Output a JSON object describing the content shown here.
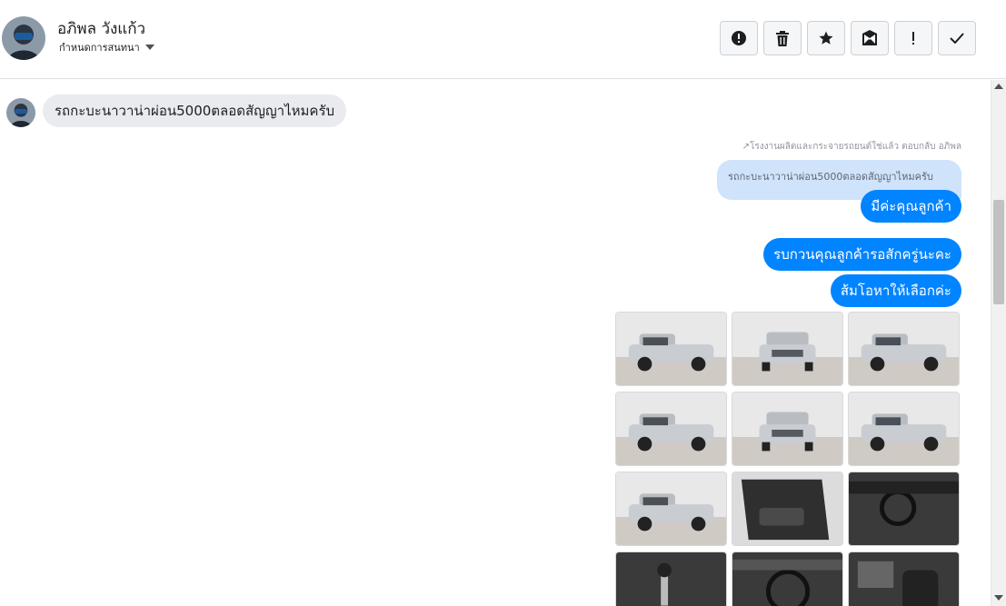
{
  "header": {
    "contact_name": "อภิพล วังแก้ว",
    "subtitle": "กำหนดการสนทนา",
    "actions": [
      {
        "icon": "alert-circle-icon",
        "name": "mark-spam-button"
      },
      {
        "icon": "trash-icon",
        "name": "delete-button"
      },
      {
        "icon": "star-icon",
        "name": "star-button"
      },
      {
        "icon": "archive-icon",
        "name": "archive-button"
      },
      {
        "icon": "exclamation-icon",
        "name": "follow-up-button"
      },
      {
        "icon": "check-icon",
        "name": "mark-done-button"
      }
    ]
  },
  "messages": {
    "incoming_1": "รถกะบะนาวาน่าผ่อน5000ตลอดสัญญาไหมครับ",
    "reply_meta": "โรงงานผลิตและกระจายรถยนต์ใช่แล้ว ตอบกลับ อภิพล",
    "quoted_text": "รถกะบะนาวาน่าผ่อน5000ตลอดสัญญาไหมครับ",
    "outgoing_1": "มีค่ะคุณลูกค้า",
    "outgoing_2": "รบกวนคุณลูกค้ารอสักครู่นะคะ",
    "outgoing_3": "ส้มโอหาให้เลือกค่ะ"
  },
  "photos": [
    {
      "view": "front-left"
    },
    {
      "view": "front"
    },
    {
      "view": "rear-right"
    },
    {
      "view": "front-left"
    },
    {
      "view": "rear"
    },
    {
      "view": "side"
    },
    {
      "view": "side"
    },
    {
      "view": "door-interior"
    },
    {
      "view": "dashboard"
    },
    {
      "view": "gear-shift"
    },
    {
      "view": "steering-wheel"
    },
    {
      "view": "driver-seat"
    }
  ],
  "colors": {
    "outgoing_bubble": "#0084ff",
    "incoming_bubble": "#e9ebee",
    "quoted_bubble": "#cfe3fb"
  }
}
